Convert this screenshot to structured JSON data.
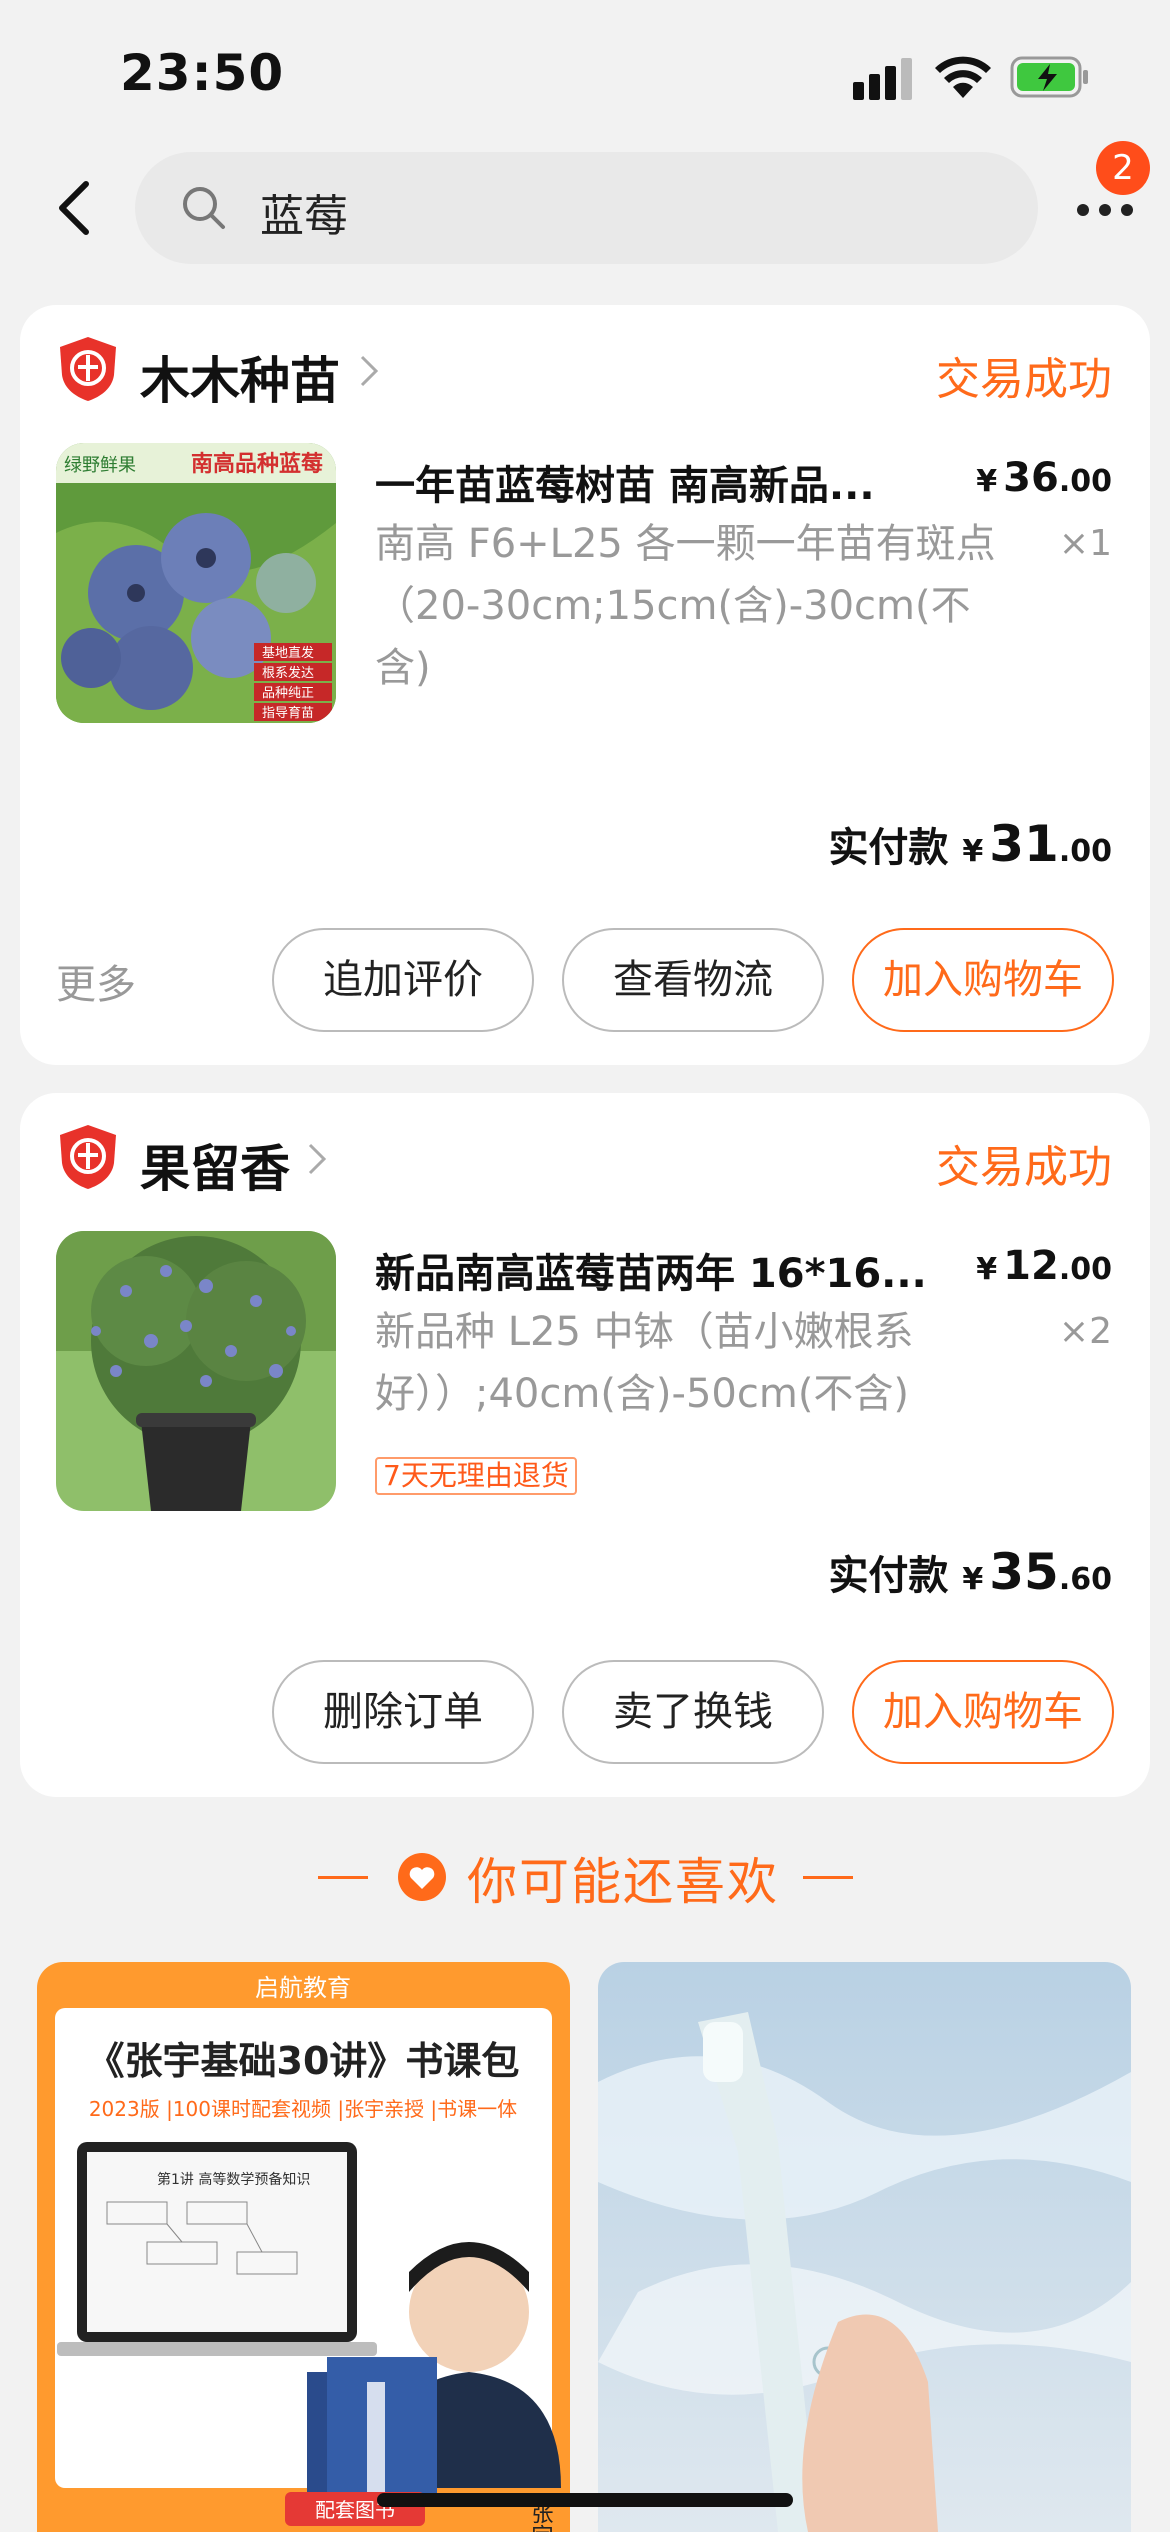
{
  "status_bar": {
    "time": "23:50"
  },
  "search": {
    "query": "蓝莓",
    "notification_count": "2"
  },
  "orders": [
    {
      "shop": "木木种苗",
      "status": "交易成功",
      "product_title": "一年苗蓝莓树苗 南高新品...",
      "price_int": "36",
      "price_dec": ".00",
      "yen": "¥",
      "spec": "南高 F6+L25 各一颗一年苗有斑点（20-30cm;15cm(含)-30cm(不含)",
      "qty": "×1",
      "paid_label": "实付款",
      "paid_int": "31",
      "paid_dec": ".00",
      "more": "更多",
      "buttons": [
        "追加评价",
        "查看物流",
        "加入购物车"
      ],
      "thumb_banner_text": "南高品种蓝莓",
      "thumb_logo_text": "绿野鲜果",
      "thumb_tags": [
        "基地直发",
        "根系发达",
        "品种纯正",
        "指导育苗"
      ]
    },
    {
      "shop": "果留香",
      "status": "交易成功",
      "product_title": "新品南高蓝莓苗两年 16*16...",
      "price_int": "12",
      "price_dec": ".00",
      "yen": "¥",
      "spec": "新品种 L25 中钵（苗小嫩根系好））;40cm(含)-50cm(不含)",
      "qty": "×2",
      "tag": "7天无理由退货",
      "paid_label": "实付款",
      "paid_int": "35",
      "paid_dec": ".60",
      "buttons": [
        "删除订单",
        "卖了换钱",
        "加入购物车"
      ]
    }
  ],
  "recommend": {
    "title": "你可能还喜欢",
    "item1": {
      "brand": "启航教育",
      "headline": "《张宇基础30讲》书课包",
      "subline": "2023版 |100课时配套视频 |张宇亲授 |书课一体",
      "name": "张宇",
      "book_tag": "配套图书",
      "slide_title": "第1讲 高等数学预备知识"
    }
  },
  "colors": {
    "accent": "#ff6a1a",
    "badge": "#ff4d1a",
    "background": "#f2f2f2"
  },
  "icons": [
    "back-icon",
    "search-icon",
    "more-icon",
    "enterprise-shield-icon",
    "chevron-right-icon",
    "heart-icon",
    "battery-charging-icon",
    "wifi-icon",
    "signal-icon"
  ]
}
